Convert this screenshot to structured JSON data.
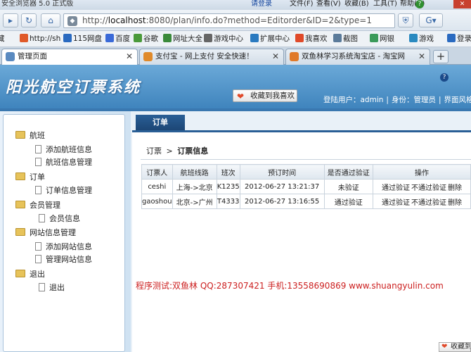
{
  "browser": {
    "title": "安全浏览器 5.0 正式版",
    "login_link": "请登录",
    "menus": [
      "文件(F)",
      "查看(V)",
      "收藏(B)",
      "工具(T)",
      "帮助(H)"
    ],
    "url_prefix": "http://",
    "url_host": "localhost",
    "url_rest": ":8080/plan/info.do?method=Editorder&ID=2&type=1"
  },
  "bookmarks": [
    {
      "label": "http://sh",
      "color": "#e05a2a"
    },
    {
      "label": "115网盘",
      "color": "#2a6ac0"
    },
    {
      "label": "百度",
      "color": "#3a6ad8"
    },
    {
      "label": "谷歌",
      "color": "#4a9a3a"
    },
    {
      "label": "网址大全",
      "color": "#3a8a3a"
    },
    {
      "label": "游戏中心",
      "color": "#666666"
    },
    {
      "label": "扩展中心",
      "color": "#2a7ac0"
    },
    {
      "label": "我喜欢",
      "color": "#e04a2a"
    },
    {
      "label": "截图",
      "color": "#5a7a9a"
    },
    {
      "label": "网银",
      "color": "#3a9a5a"
    },
    {
      "label": "游戏",
      "color": "#2a8ac0"
    },
    {
      "label": "登录",
      "color": "#2a6ac0"
    }
  ],
  "tabs": [
    {
      "label": "管理页面",
      "active": true,
      "color": "#5a8ac0"
    },
    {
      "label": "支付宝 - 网上支付 安全快速！",
      "active": false,
      "color": "#e08a2a"
    },
    {
      "label": "双鱼林学习系统淘宝店 - 淘宝网",
      "active": false,
      "color": "#e07a2a"
    }
  ],
  "header": {
    "logo": "阳光航空订票系统",
    "fav_button": "收藏到我喜欢",
    "login_user_label": "登陆用户：",
    "login_user": "admin",
    "role_label": "身份：",
    "role": "管理员",
    "style_label": "界面风格："
  },
  "sidebar": {
    "groups": [
      {
        "label": "航班",
        "items": [
          "添加航班信息",
          "航班信息管理"
        ]
      },
      {
        "label": "订单",
        "items": [
          "订单信息管理"
        ]
      },
      {
        "label": "会员管理",
        "items": [
          "会员信息"
        ]
      },
      {
        "label": "网站信息管理",
        "items": [
          "添加网站信息",
          "管理网站信息"
        ]
      },
      {
        "label": "退出",
        "items": [
          "退出"
        ]
      }
    ]
  },
  "main": {
    "tab": "订单",
    "breadcrumb_root": "订票",
    "breadcrumb_sep": ">",
    "breadcrumb_current": "订票信息",
    "columns": [
      "订票人",
      "航班线路",
      "班次",
      "预订时间",
      "是否通过验证",
      "操作"
    ],
    "rows": [
      {
        "name": "ceshi",
        "route": "上海->北京",
        "flight": "K1235",
        "time": "2012-06-27 13:21:37",
        "status": "未验证",
        "verified": false
      },
      {
        "name": "gaoshou",
        "route": "北京->广州",
        "flight": "T4333",
        "time": "2012-06-27 13:16:55",
        "status": "通过验证",
        "verified": true
      }
    ],
    "actions": [
      "通过验证",
      "不通过验证",
      "删除"
    ]
  },
  "footer_note": "程序测试:双鱼林 QQ:287307421 手机:13558690869 www.shuangyulin.com",
  "bottom_fav": "收藏到我喜欢"
}
